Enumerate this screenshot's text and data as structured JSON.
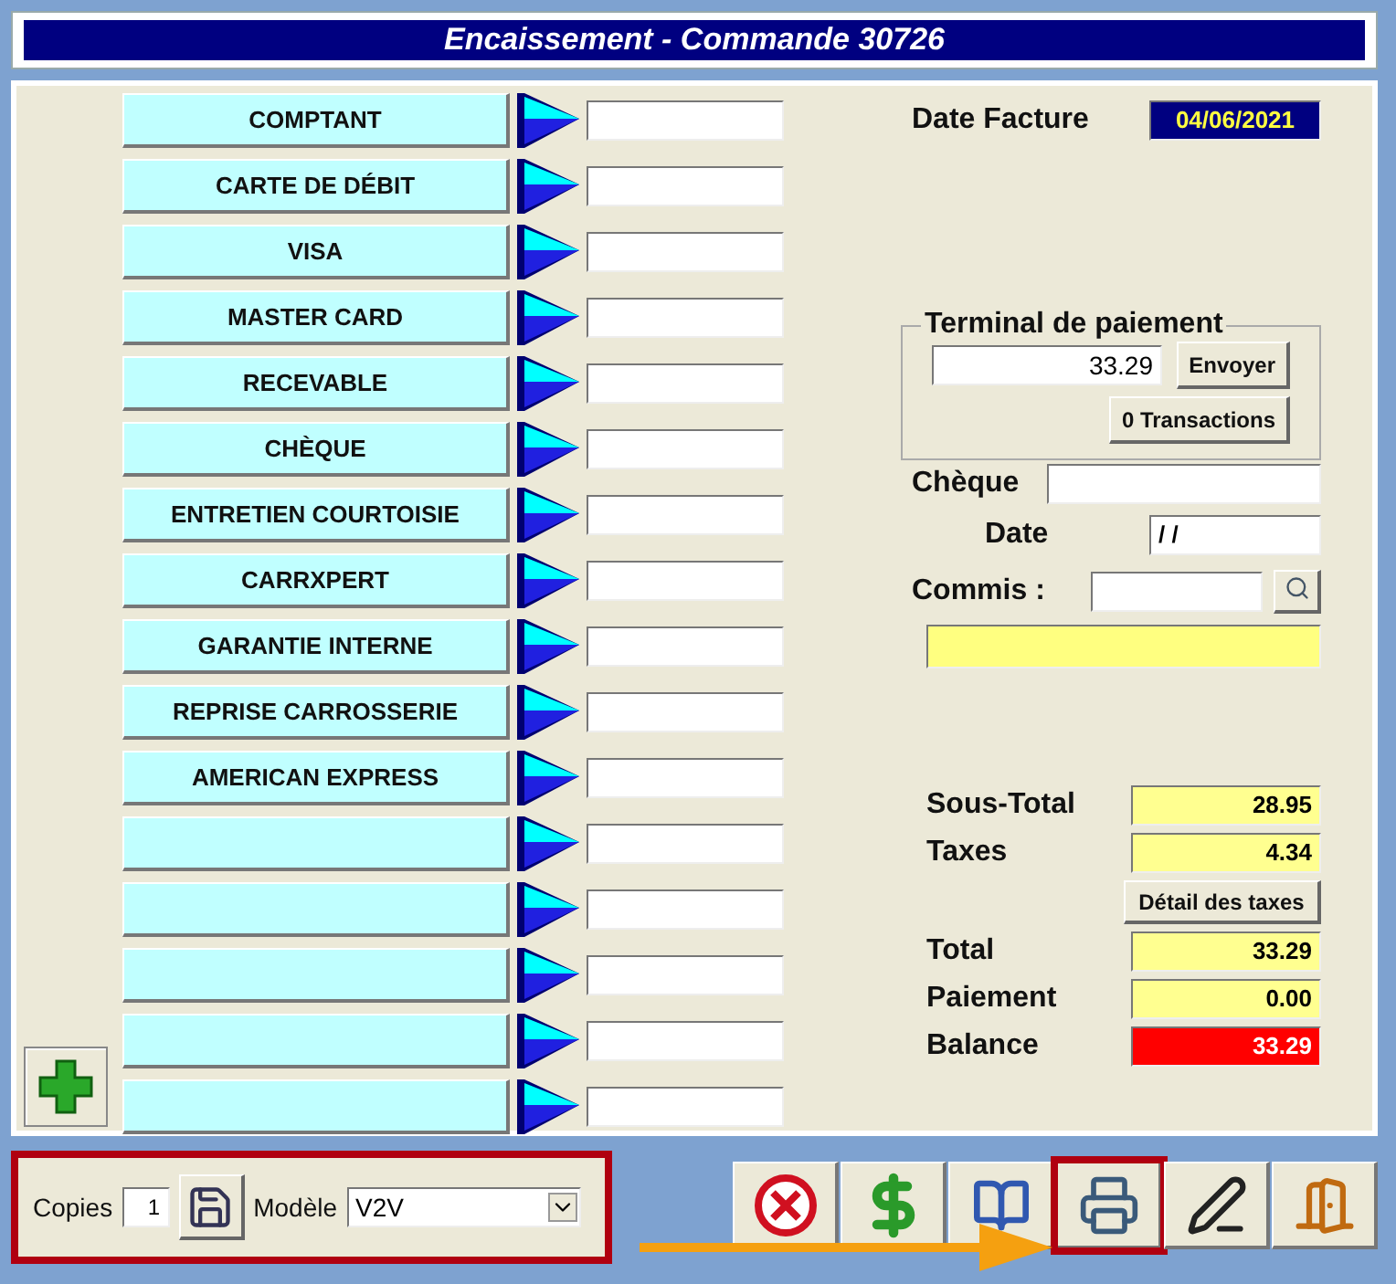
{
  "title": "Encaissement - Commande 30726",
  "payment_rows": [
    {
      "kind": "method",
      "label": "COMPTANT"
    },
    {
      "kind": "method",
      "label": "CARTE DE DÉBIT"
    },
    {
      "kind": "method",
      "label": "VISA"
    },
    {
      "kind": "method",
      "label": "MASTER CARD"
    },
    {
      "kind": "method",
      "label": "RECEVABLE"
    },
    {
      "kind": "method",
      "label": "CHÈQUE"
    },
    {
      "kind": "method",
      "label": "ENTRETIEN COURTOISIE"
    },
    {
      "kind": "method",
      "label": "CARRXPERT"
    },
    {
      "kind": "method",
      "label": "GARANTIE INTERNE"
    },
    {
      "kind": "method",
      "label": "REPRISE CARROSSERIE"
    },
    {
      "kind": "method",
      "label": "AMERICAN EXPRESS"
    },
    {
      "kind": "empty"
    },
    {
      "kind": "empty"
    },
    {
      "kind": "empty"
    },
    {
      "kind": "empty"
    },
    {
      "kind": "empty"
    }
  ],
  "date_facture": {
    "label": "Date Facture",
    "value": "04/06/2021"
  },
  "terminal": {
    "title": "Terminal de paiement",
    "amount": "33.29",
    "send_button": "Envoyer",
    "transactions_button": "0 Transactions"
  },
  "cheque": {
    "label": "Chèque"
  },
  "date": {
    "label": "Date",
    "value": "/ /"
  },
  "commis": {
    "label": "Commis :"
  },
  "totals": [
    {
      "label": "Sous-Total",
      "value": "28.95",
      "kind": "normal"
    },
    {
      "label": "Taxes",
      "value": "4.34",
      "kind": "normal"
    },
    {
      "kind": "button",
      "label": "Détail des taxes"
    },
    {
      "label": "Total",
      "value": "33.29",
      "kind": "normal"
    },
    {
      "label": "Paiement",
      "value": "0.00",
      "kind": "normal"
    },
    {
      "label": "Balance",
      "value": "33.29",
      "kind": "alert"
    }
  ],
  "print_options": {
    "highlighted": true,
    "copies_label": "Copies",
    "copies": "1",
    "model_label": "Modèle",
    "model": "V2V"
  },
  "toolbar": [
    {
      "kind": "cancel",
      "highlighted": false
    },
    {
      "kind": "pay",
      "highlighted": false
    },
    {
      "kind": "book",
      "highlighted": false
    },
    {
      "kind": "print",
      "highlighted": true
    },
    {
      "kind": "sign",
      "highlighted": false
    },
    {
      "kind": "exit",
      "highlighted": false
    }
  ]
}
